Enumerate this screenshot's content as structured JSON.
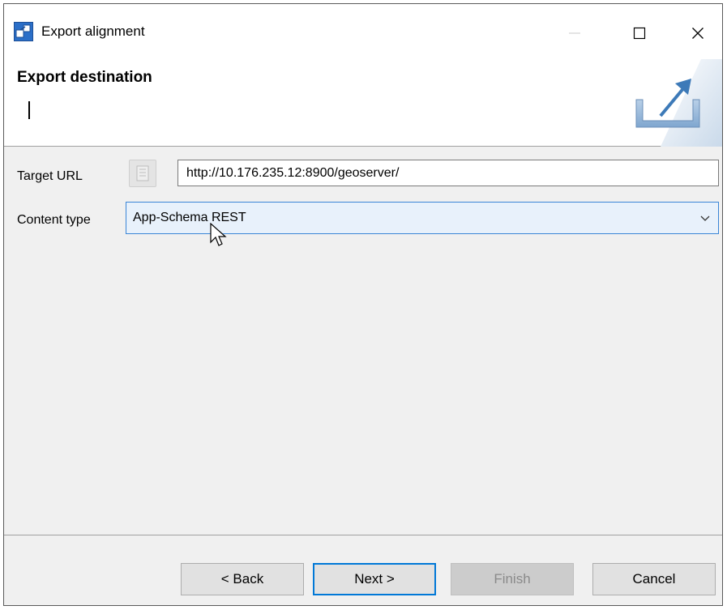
{
  "window": {
    "title": "Export alignment",
    "controls": {
      "minimize": "minimize-icon",
      "maximize": "maximize-icon",
      "close": "close-icon"
    }
  },
  "banner": {
    "title": "Export destination",
    "message": "",
    "icon": "export-icon"
  },
  "form": {
    "target_url_label": "Target URL",
    "target_url_value": "http://10.176.235.12:8900/geoserver/",
    "content_type_label": "Content type",
    "content_type_value": "App-Schema REST"
  },
  "buttons": {
    "back": "< Back",
    "next": "Next >",
    "finish": "Finish",
    "cancel": "Cancel"
  },
  "colors": {
    "accent": "#0078d7",
    "combo_bg": "#e8f1fb",
    "dialog_bg": "#f0f0f0"
  }
}
